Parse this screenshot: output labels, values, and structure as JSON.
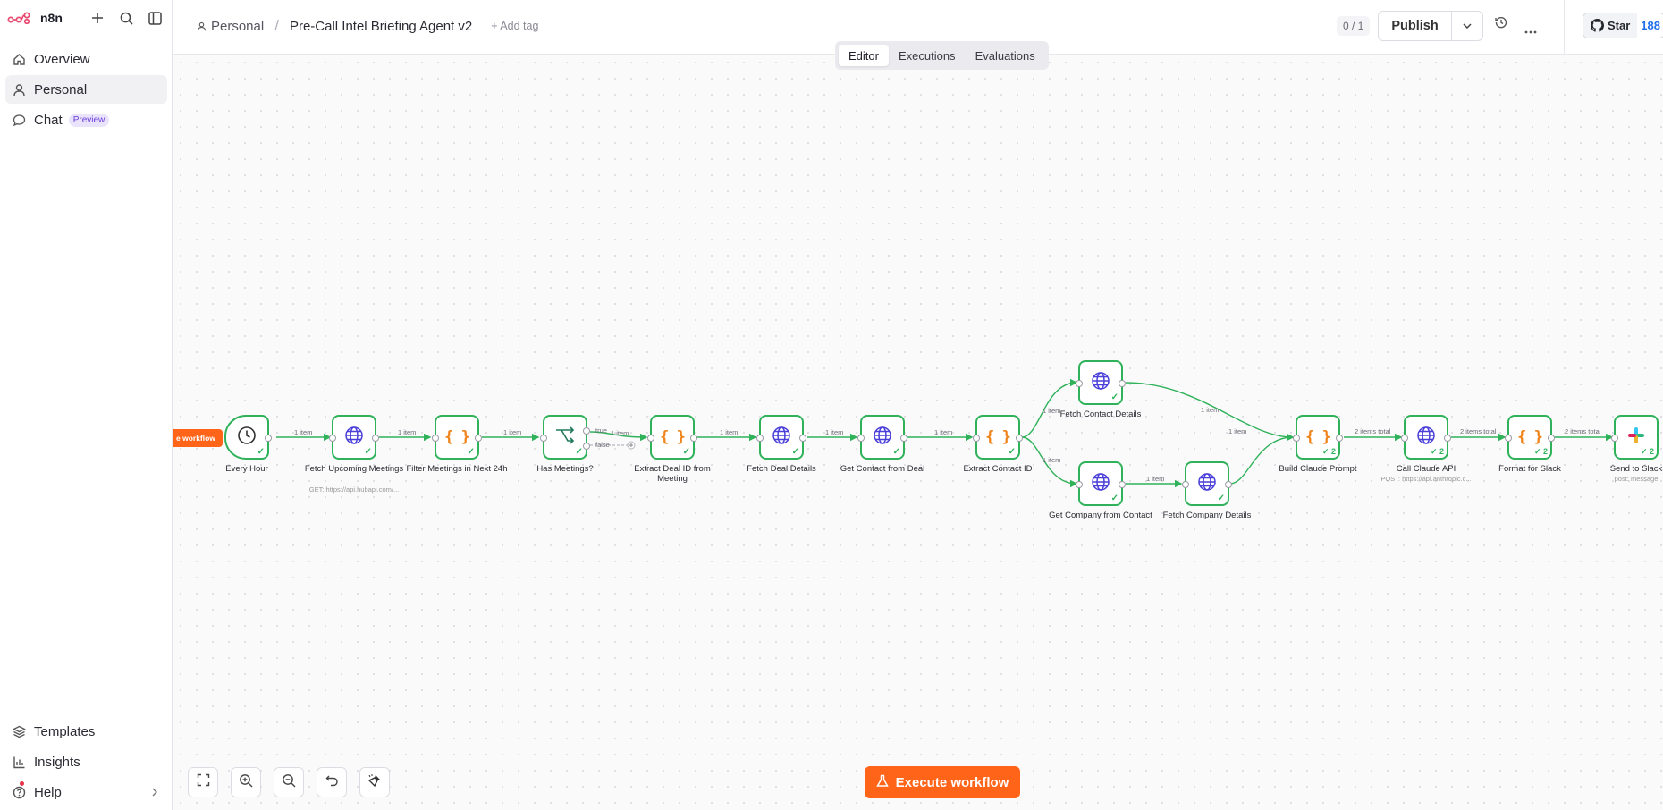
{
  "brand": {
    "name": "n8n"
  },
  "sidebar": {
    "items": [
      {
        "label": "Overview",
        "icon": "home-icon"
      },
      {
        "label": "Personal",
        "icon": "user-icon"
      },
      {
        "label": "Chat",
        "icon": "chat-icon",
        "badge": "Preview"
      }
    ],
    "bottom": [
      {
        "label": "Templates",
        "icon": "templates-icon"
      },
      {
        "label": "Insights",
        "icon": "insights-icon"
      },
      {
        "label": "Help",
        "icon": "help-icon"
      }
    ]
  },
  "header": {
    "project": "Personal",
    "workflow_name": "Pre-Call Intel Briefing Agent v2",
    "add_tag": "+ Add tag",
    "counter": "0 / 1",
    "publish": "Publish",
    "star": "Star",
    "star_count": "188"
  },
  "tabs": [
    "Editor",
    "Executions",
    "Evaluations"
  ],
  "canvas": {
    "trigger_pill": "e workflow",
    "nodes": [
      {
        "label": "Every Hour"
      },
      {
        "label": "Fetch Upcoming Meetings",
        "sub": "GET: https://api.hubapi.com/..."
      },
      {
        "label": "Filter Meetings in Next 24h"
      },
      {
        "label": "Has Meetings?"
      },
      {
        "label": "Extract Deal ID from Meeting"
      },
      {
        "label": "Fetch Deal Details"
      },
      {
        "label": "Get Contact from Deal"
      },
      {
        "label": "Extract Contact ID"
      },
      {
        "label": "Fetch Contact Details"
      },
      {
        "label": "Get Company from Contact"
      },
      {
        "label": "Fetch Company Details"
      },
      {
        "label": "Build Claude Prompt",
        "count": "2"
      },
      {
        "label": "Call Claude API",
        "sub": "POST: https://api.anthropic.c...",
        "count": "2"
      },
      {
        "label": "Format for Slack",
        "count": "2"
      },
      {
        "label": "Send to Slack",
        "sub": "post: message",
        "count": "2"
      }
    ],
    "edge_labels": {
      "one_item": "1 item",
      "true": "true",
      "false": "false",
      "two_items": "2 items total"
    }
  },
  "execute_button": "Execute workflow",
  "colors": {
    "accent": "#ff6418",
    "success": "#2fb25a",
    "http": "#4a3fd8",
    "code": "#f0831a"
  }
}
